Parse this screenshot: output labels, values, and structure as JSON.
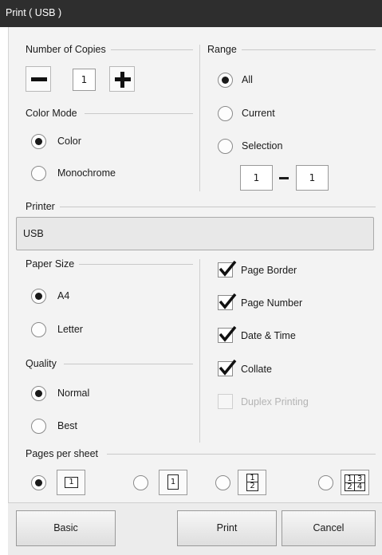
{
  "window": {
    "title": "Print ( USB )"
  },
  "copies": {
    "label": "Number of Copies",
    "value": "1",
    "decrement_icon": "minus-icon",
    "increment_icon": "plus-icon"
  },
  "color_mode": {
    "label": "Color Mode",
    "options": [
      {
        "label": "Color",
        "selected": true
      },
      {
        "label": "Monochrome",
        "selected": false
      }
    ]
  },
  "range": {
    "label": "Range",
    "options": [
      {
        "label": "All",
        "selected": true
      },
      {
        "label": "Current",
        "selected": false
      },
      {
        "label": "Selection",
        "selected": false
      }
    ],
    "from": "1",
    "to": "1"
  },
  "printer": {
    "label": "Printer",
    "value": "USB"
  },
  "paper_size": {
    "label": "Paper Size",
    "options": [
      {
        "label": "A4",
        "selected": true
      },
      {
        "label": "Letter",
        "selected": false
      }
    ]
  },
  "quality": {
    "label": "Quality",
    "options": [
      {
        "label": "Normal",
        "selected": true
      },
      {
        "label": "Best",
        "selected": false
      }
    ]
  },
  "options": [
    {
      "label": "Page Border",
      "checked": true,
      "enabled": true
    },
    {
      "label": "Page Number",
      "checked": true,
      "enabled": true
    },
    {
      "label": "Date & Time",
      "checked": true,
      "enabled": true
    },
    {
      "label": "Collate",
      "checked": true,
      "enabled": true
    },
    {
      "label": "Duplex Printing",
      "checked": false,
      "enabled": false
    }
  ],
  "pages_per_sheet": {
    "label": "Pages per sheet",
    "options": [
      {
        "icon": "one-page-icon",
        "selected": true,
        "glyphs": [
          "1"
        ]
      },
      {
        "icon": "one-page-portrait-icon",
        "selected": false,
        "glyphs": [
          "1"
        ]
      },
      {
        "icon": "two-pages-icon",
        "selected": false,
        "glyphs": [
          "1",
          "2"
        ]
      },
      {
        "icon": "four-pages-icon",
        "selected": false,
        "glyphs": [
          "1",
          "3",
          "2",
          "4"
        ]
      }
    ]
  },
  "buttons": {
    "basic": "Basic",
    "print": "Print",
    "cancel": "Cancel"
  },
  "colors": {
    "titlebar": "#2e2e2e",
    "panel": "#f3f3f3",
    "printer_field": "#e8e8e8",
    "check": "#111111"
  }
}
